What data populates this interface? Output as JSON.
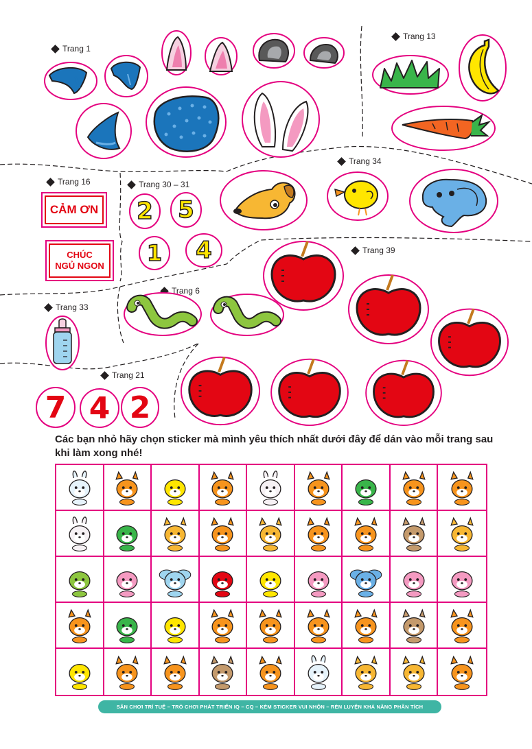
{
  "page_labels": {
    "trang1": "Trang 1",
    "trang13": "Trang 13",
    "trang16": "Trang 16",
    "trang30": "Trang 30 – 31",
    "trang34": "Trang 34",
    "trang39": "Trang 39",
    "trang6": "Trang 6",
    "trang33": "Trang 33",
    "trang21": "Trang 21"
  },
  "word_stickers": {
    "cam_on": "CẢM ƠN",
    "chuc_line1": "CHÚC",
    "chuc_line2": "NGỦ NGON"
  },
  "number_stickers_30": [
    "2",
    "5",
    "1",
    "4"
  ],
  "number_stickers_21": [
    "7",
    "4",
    "2"
  ],
  "instruction": "Các bạn nhỏ hãy chọn sticker mà mình yêu thích nhất dưới đây để dán vào mỗi trang sau khi làm xong nhé!",
  "grid": {
    "rows": 5,
    "columns": 9,
    "animals": [
      [
        "unicorn",
        "shiba",
        "duck",
        "shiba",
        "bunny",
        "shiba",
        "turtle",
        "shiba",
        "shiba"
      ],
      [
        "bunny",
        "turtle",
        "cat",
        "shiba",
        "cat",
        "shiba",
        "shiba",
        "bear",
        "cat"
      ],
      [
        "frog",
        "bird",
        "dragonfly",
        "ladybug",
        "bee",
        "snail",
        "butterfly",
        "bird",
        "bird"
      ],
      [
        "shiba",
        "turtle",
        "duck",
        "shiba",
        "shiba",
        "shiba",
        "shiba",
        "bear",
        "shiba"
      ],
      [
        "duck",
        "shiba",
        "shiba",
        "bear",
        "shiba",
        "unicorn",
        "cat",
        "cat",
        "shiba"
      ]
    ]
  },
  "footer": "SÂN CHƠI TRÍ TUỆ – TRÒ CHƠI PHÁT TRIỂN IQ – CQ – KÈM STICKER VUI NHỘN – RÈN LUYỆN KHẢ NĂNG PHÂN TÍCH",
  "colors": {
    "magenta_outline": "#e4007f",
    "red": "#e30613",
    "yellow": "#ffe600",
    "blue": "#1b75bb",
    "green": "#39b54a",
    "teal": "#3fb5a4",
    "orange": "#f7941d"
  }
}
